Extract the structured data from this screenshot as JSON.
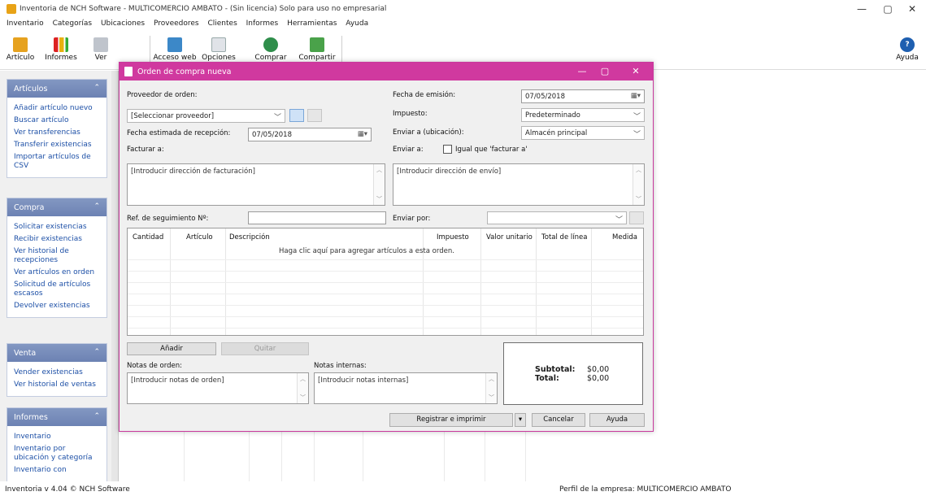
{
  "window": {
    "title": "Inventoria de NCH Software - MULTICOMERCIO AMBATO - (Sin licencia) Solo para uso no empresarial",
    "minimize": "—",
    "maximize": "▢",
    "close": "✕"
  },
  "menu": [
    "Inventario",
    "Categorías",
    "Ubicaciones",
    "Proveedores",
    "Clientes",
    "Informes",
    "Herramientas",
    "Ayuda"
  ],
  "toolbar": {
    "articulo": "Artículo",
    "informes": "Informes",
    "ver": "Ver",
    "acceso_web": "Acceso web",
    "opciones": "Opciones",
    "comprar": "Comprar",
    "compartir": "Compartir",
    "ayuda": "Ayuda"
  },
  "sidebar": {
    "articulos": {
      "title": "Artículos",
      "links": [
        "Añadir artículo nuevo",
        "Buscar artículo",
        "Ver transferencias",
        "Transferir existencias",
        "Importar artículos de CSV"
      ]
    },
    "compra": {
      "title": "Compra",
      "links": [
        "Solicitar existencias",
        "Recibir existencias",
        "Ver historial de recepciones",
        "Ver artículos en orden",
        "Solicitud de artículos escasos",
        "Devolver existencias"
      ]
    },
    "venta": {
      "title": "Venta",
      "links": [
        "Vender existencias",
        "Ver historial de ventas"
      ]
    },
    "informes": {
      "title": "Informes",
      "links": [
        "Inventario",
        "Inventario por ubicación y categoría",
        "Inventario con"
      ]
    }
  },
  "status": {
    "left": "Inventoria v 4.04 © NCH Software",
    "right": "Perfil de la empresa: MULTICOMERCIO AMBATO"
  },
  "dialog": {
    "title": "Orden de compra nueva",
    "proveedor_label": "Proveedor de orden:",
    "proveedor_value": "[Seleccionar proveedor]",
    "fecha_recepcion_label": "Fecha estimada de recepción:",
    "fecha_recepcion_value": "07/05/2018",
    "facturar_label": "Facturar a:",
    "facturar_placeholder": "[Introducir dirección de facturación]",
    "fecha_emision_label": "Fecha de emisión:",
    "fecha_emision_value": "07/05/2018",
    "impuesto_label": "Impuesto:",
    "impuesto_value": "Predeterminado",
    "enviar_ubicacion_label": "Enviar a (ubicación):",
    "enviar_ubicacion_value": "Almacén principal",
    "enviar_a_label": "Enviar a:",
    "igual_label": "Igual que 'facturar a'",
    "envio_placeholder": "[Introducir dirección de envío]",
    "ref_label": "Ref. de seguimiento Nº:",
    "ref_value": "",
    "enviar_por_label": "Enviar por:",
    "enviar_por_value": "",
    "columns": [
      "Cantidad",
      "Artículo",
      "Descripción",
      "Impuesto",
      "Valor unitario",
      "Total de línea",
      "Medida"
    ],
    "empty_hint": "Haga clic aquí para agregar artículos a esta orden.",
    "anadir": "Añadir",
    "quitar": "Quitar",
    "notas_orden_label": "Notas de orden:",
    "notas_orden_placeholder": "[Introducir notas de orden]",
    "notas_internas_label": "Notas internas:",
    "notas_internas_placeholder": "[Introducir notas internas]",
    "subtotal_label": "Subtotal:",
    "subtotal_value": "$0,00",
    "total_label": "Total:",
    "total_value": "$0,00",
    "registrar": "Registrar e imprimir",
    "cancelar": "Cancelar",
    "ayuda": "Ayuda"
  },
  "colors": {
    "dialog_accent": "#d0399f",
    "sidebar_header": "#6c82b3",
    "link": "#1c4fa6"
  }
}
